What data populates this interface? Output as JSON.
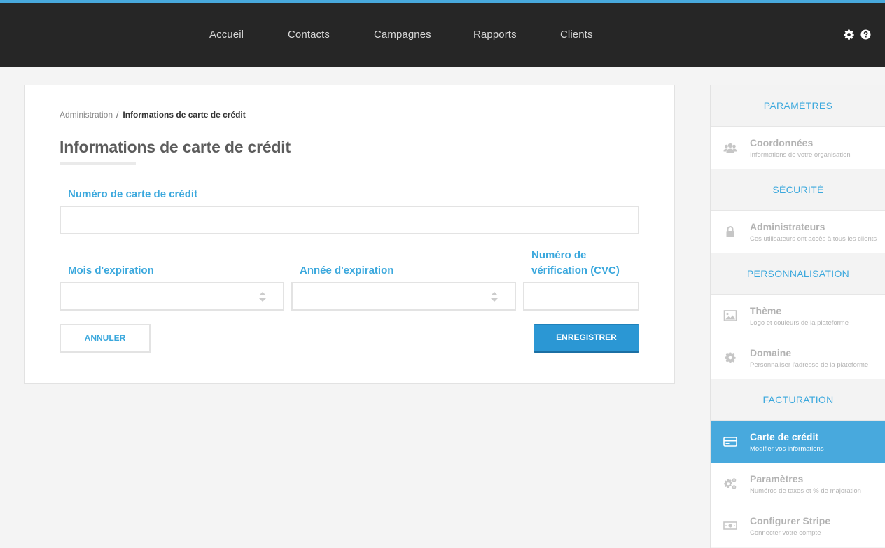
{
  "nav": {
    "links": [
      "Accueil",
      "Contacts",
      "Campagnes",
      "Rapports",
      "Clients"
    ],
    "icons": [
      "gear-icon",
      "help-icon"
    ]
  },
  "breadcrumb": {
    "parent": "Administration",
    "separator": "/",
    "current": "Informations de carte de crédit"
  },
  "page": {
    "title": "Informations de carte de crédit"
  },
  "form": {
    "card_number_label": "Numéro de carte de crédit",
    "card_number_value": "",
    "exp_month_label": "Mois d'expiration",
    "exp_month_value": "",
    "exp_year_label": "Année d'expiration",
    "exp_year_value": "",
    "cvc_label_line1": "Numéro de",
    "cvc_label_line2": "vérification (CVC)",
    "cvc_value": "",
    "cancel_label": "ANNULER",
    "save_label": "ENREGISTRER"
  },
  "sidebar": {
    "sections": [
      {
        "title": "PARAMÈTRES",
        "items": [
          {
            "icon": "users-icon",
            "title": "Coordonnées",
            "subtitle": "Informations de votre organisation",
            "active": false
          }
        ]
      },
      {
        "title": "SÉCURITÉ",
        "items": [
          {
            "icon": "lock-icon",
            "title": "Administrateurs",
            "subtitle": "Ces utilisateurs ont accès à tous les clients",
            "active": false
          }
        ]
      },
      {
        "title": "PERSONNALISATION",
        "items": [
          {
            "icon": "image-icon",
            "title": "Thème",
            "subtitle": "Logo et couleurs de la plateforme",
            "active": false
          },
          {
            "icon": "gear-icon",
            "title": "Domaine",
            "subtitle": "Personnaliser l'adresse de la plateforme",
            "active": false
          }
        ]
      },
      {
        "title": "FACTURATION",
        "items": [
          {
            "icon": "credit-card-icon",
            "title": "Carte de crédit",
            "subtitle": "Modifier vos informations",
            "active": true
          },
          {
            "icon": "gears-icon",
            "title": "Paramètres",
            "subtitle": "Numéros de taxes et % de majoration",
            "active": false
          },
          {
            "icon": "money-icon",
            "title": "Configurer Stripe",
            "subtitle": "Connecter votre compte",
            "active": false
          }
        ]
      }
    ]
  },
  "colors": {
    "accent": "#3ba8dd",
    "topbar": "#262626",
    "save_button": "#2b97d4",
    "active_item": "#48a9dd"
  }
}
